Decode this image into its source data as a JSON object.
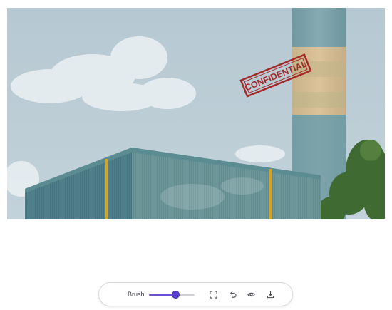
{
  "canvas": {
    "stamp_text": "CONFIDENTIAL"
  },
  "toolbar": {
    "brush_label": "Brush",
    "brush_size": 0.58,
    "accent_color": "#5b3fd0",
    "buttons": [
      {
        "name": "fit-to-screen",
        "icon": "expand-icon"
      },
      {
        "name": "undo",
        "icon": "undo-icon"
      },
      {
        "name": "preview",
        "icon": "eye-icon"
      },
      {
        "name": "download",
        "icon": "download-icon"
      }
    ]
  }
}
